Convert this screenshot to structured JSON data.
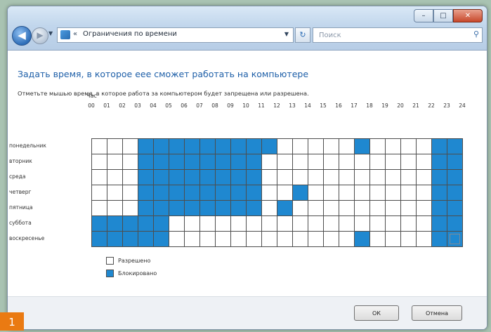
{
  "window": {
    "controls": {
      "minimize": "–",
      "maximize": "□",
      "close": "✕"
    }
  },
  "toolbar": {
    "back_glyph": "◀",
    "forward_glyph": "▶",
    "address": {
      "prefix": "«",
      "text": "Ограничения по времени",
      "icon": "control-panel-icon"
    },
    "search_placeholder": "Поиск"
  },
  "page": {
    "heading": "Задать время, в которое еее сможет работать на компьютере",
    "instruction": "Отметьте мышью время, в которое работа за компьютером будет запрещена или разрешена."
  },
  "schedule": {
    "hour_caption": "Час",
    "hours": [
      "00",
      "01",
      "02",
      "03",
      "04",
      "05",
      "06",
      "07",
      "08",
      "09",
      "10",
      "11",
      "12",
      "13",
      "14",
      "15",
      "16",
      "17",
      "18",
      "19",
      "20",
      "21",
      "22",
      "23",
      "24"
    ],
    "days": [
      "понедельник",
      "вторник",
      "среда",
      "четверг",
      "пятница",
      "суббота",
      "воскресенье"
    ],
    "blocked_color": "#1f88d0",
    "grid": [
      [
        0,
        0,
        0,
        1,
        1,
        1,
        1,
        1,
        1,
        1,
        1,
        1,
        0,
        0,
        0,
        0,
        0,
        1,
        0,
        0,
        0,
        0,
        1,
        1
      ],
      [
        0,
        0,
        0,
        1,
        1,
        1,
        1,
        1,
        1,
        1,
        1,
        0,
        0,
        0,
        0,
        0,
        0,
        0,
        0,
        0,
        0,
        0,
        1,
        1
      ],
      [
        0,
        0,
        0,
        1,
        1,
        1,
        1,
        1,
        1,
        1,
        1,
        0,
        0,
        0,
        0,
        0,
        0,
        0,
        0,
        0,
        0,
        0,
        1,
        1
      ],
      [
        0,
        0,
        0,
        1,
        1,
        1,
        1,
        1,
        1,
        1,
        1,
        0,
        0,
        1,
        0,
        0,
        0,
        0,
        0,
        0,
        0,
        0,
        1,
        1
      ],
      [
        0,
        0,
        0,
        1,
        1,
        1,
        1,
        1,
        1,
        1,
        1,
        0,
        1,
        0,
        0,
        0,
        0,
        0,
        0,
        0,
        0,
        0,
        1,
        1
      ],
      [
        1,
        1,
        1,
        1,
        1,
        0,
        0,
        0,
        0,
        0,
        0,
        0,
        0,
        0,
        0,
        0,
        0,
        0,
        0,
        0,
        0,
        0,
        1,
        1
      ],
      [
        1,
        1,
        1,
        1,
        1,
        0,
        0,
        0,
        0,
        0,
        0,
        0,
        0,
        0,
        0,
        0,
        0,
        1,
        0,
        0,
        0,
        0,
        1,
        1
      ]
    ]
  },
  "legend": {
    "allowed": "Разрешено",
    "blocked": "Блокировано"
  },
  "buttons": {
    "ok": "ОК",
    "cancel": "Отмена"
  },
  "badge": "1"
}
